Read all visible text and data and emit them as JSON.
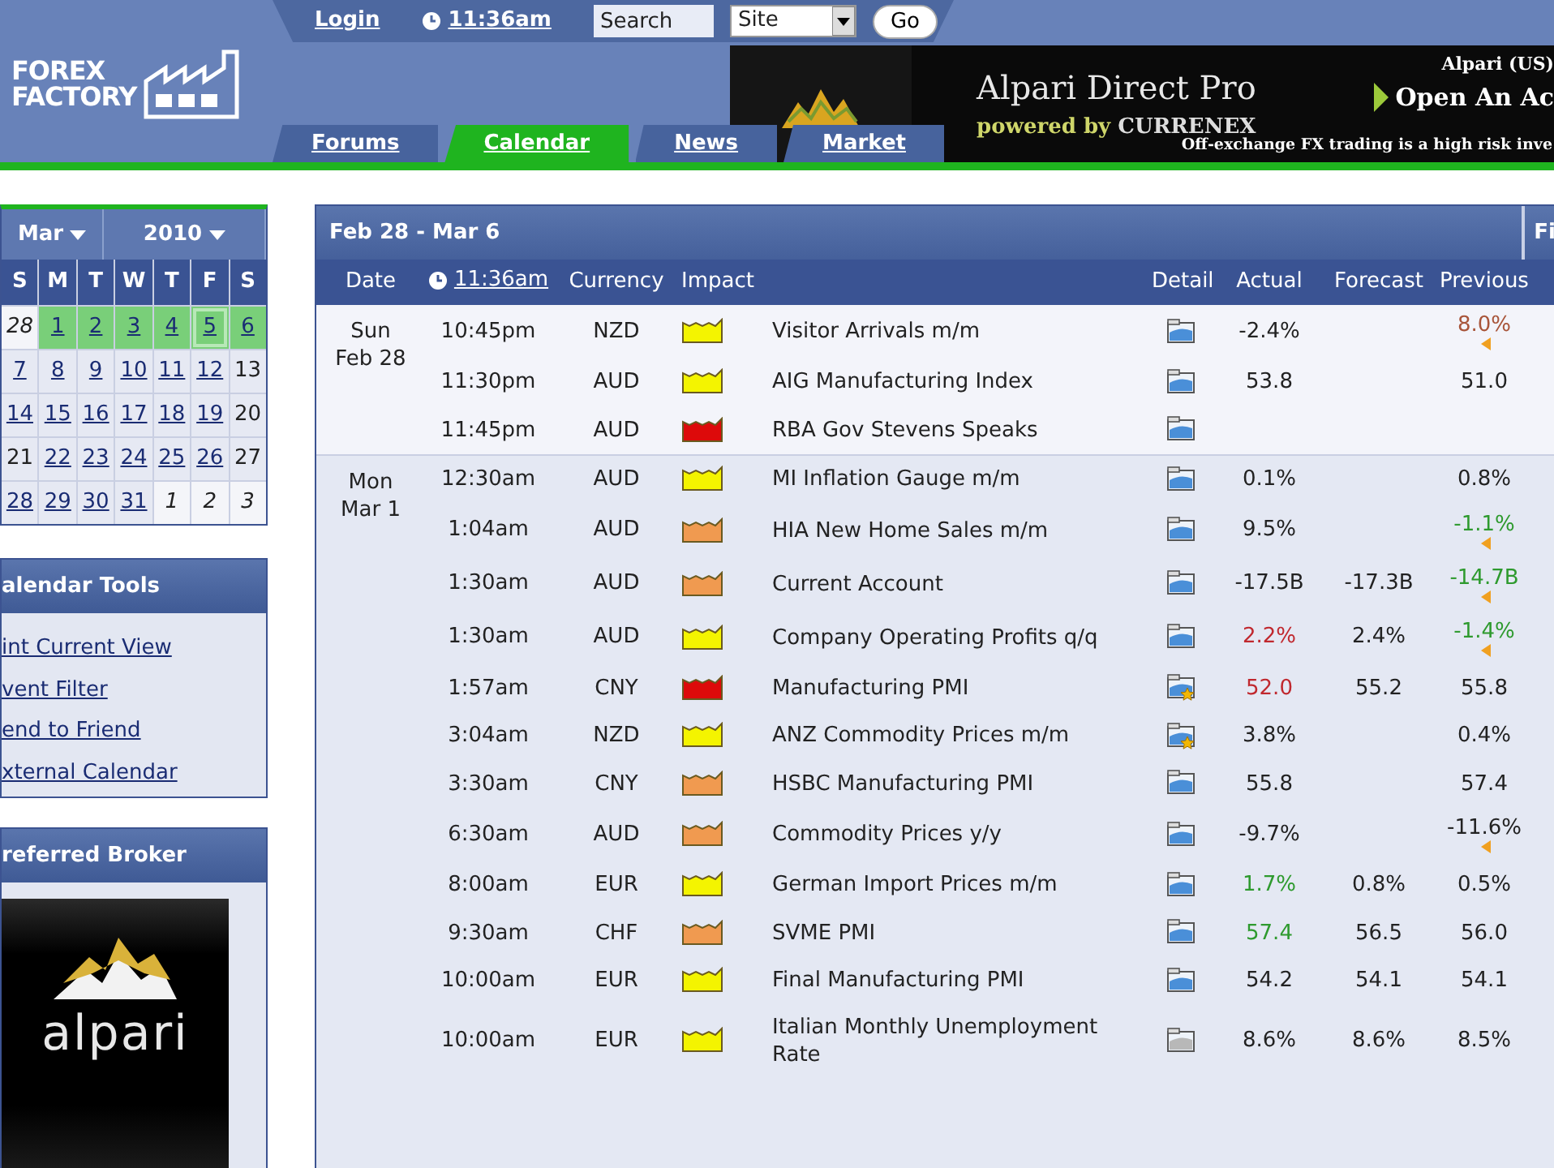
{
  "top_bar": {
    "login": "Login",
    "clock_time": "11:36am",
    "search": {
      "value": "Search"
    },
    "scope": {
      "value": "Site"
    },
    "go": "Go"
  },
  "logo": {
    "line1": "FOREX",
    "line2": "FACTORY"
  },
  "tabs": [
    {
      "label": "Forums",
      "selected": false
    },
    {
      "label": "Calendar",
      "selected": true
    },
    {
      "label": "News",
      "selected": false
    },
    {
      "label": "Market",
      "selected": false
    }
  ],
  "banner": {
    "title": "Alpari Direct Pro",
    "subtitle_prefix": "powered by",
    "subtitle_brand": "CURRENEX",
    "corner": "Alpari (US)",
    "cta": "Open An Ac",
    "disclaimer": "Off-exchange FX trading is a high risk inve"
  },
  "calendar": {
    "month": "Mar",
    "year": "2010",
    "weekdays": [
      "S",
      "M",
      "T",
      "W",
      "T",
      "F",
      "S"
    ],
    "weeks": [
      [
        {
          "d": "28",
          "kind": "other",
          "selected": false,
          "today": false
        },
        {
          "d": "1",
          "kind": "link",
          "selected": true,
          "today": false
        },
        {
          "d": "2",
          "kind": "link",
          "selected": true,
          "today": false
        },
        {
          "d": "3",
          "kind": "link",
          "selected": true,
          "today": false
        },
        {
          "d": "4",
          "kind": "link",
          "selected": true,
          "today": false
        },
        {
          "d": "5",
          "kind": "link",
          "selected": true,
          "today": true
        },
        {
          "d": "6",
          "kind": "link",
          "selected": true,
          "today": false
        }
      ],
      [
        {
          "d": "7",
          "kind": "link",
          "selected": false,
          "today": false
        },
        {
          "d": "8",
          "kind": "link",
          "selected": false,
          "today": false
        },
        {
          "d": "9",
          "kind": "link",
          "selected": false,
          "today": false
        },
        {
          "d": "10",
          "kind": "link",
          "selected": false,
          "today": false
        },
        {
          "d": "11",
          "kind": "link",
          "selected": false,
          "today": false
        },
        {
          "d": "12",
          "kind": "link",
          "selected": false,
          "today": false
        },
        {
          "d": "13",
          "kind": "plain",
          "selected": false,
          "today": false
        }
      ],
      [
        {
          "d": "14",
          "kind": "link",
          "selected": false,
          "today": false
        },
        {
          "d": "15",
          "kind": "link",
          "selected": false,
          "today": false
        },
        {
          "d": "16",
          "kind": "link",
          "selected": false,
          "today": false
        },
        {
          "d": "17",
          "kind": "link",
          "selected": false,
          "today": false
        },
        {
          "d": "18",
          "kind": "link",
          "selected": false,
          "today": false
        },
        {
          "d": "19",
          "kind": "link",
          "selected": false,
          "today": false
        },
        {
          "d": "20",
          "kind": "plain",
          "selected": false,
          "today": false
        }
      ],
      [
        {
          "d": "21",
          "kind": "plain",
          "selected": false,
          "today": false
        },
        {
          "d": "22",
          "kind": "link",
          "selected": false,
          "today": false
        },
        {
          "d": "23",
          "kind": "link",
          "selected": false,
          "today": false
        },
        {
          "d": "24",
          "kind": "link",
          "selected": false,
          "today": false
        },
        {
          "d": "25",
          "kind": "link",
          "selected": false,
          "today": false
        },
        {
          "d": "26",
          "kind": "link",
          "selected": false,
          "today": false
        },
        {
          "d": "27",
          "kind": "plain",
          "selected": false,
          "today": false
        }
      ],
      [
        {
          "d": "28",
          "kind": "link",
          "selected": false,
          "today": false
        },
        {
          "d": "29",
          "kind": "link",
          "selected": false,
          "today": false
        },
        {
          "d": "30",
          "kind": "link",
          "selected": false,
          "today": false
        },
        {
          "d": "31",
          "kind": "link",
          "selected": false,
          "today": false
        },
        {
          "d": "1",
          "kind": "other",
          "selected": false,
          "today": false
        },
        {
          "d": "2",
          "kind": "other",
          "selected": false,
          "today": false
        },
        {
          "d": "3",
          "kind": "other",
          "selected": false,
          "today": false
        }
      ]
    ]
  },
  "calendar_tools": {
    "title": "alendar Tools",
    "links": [
      "int Current View",
      "vent Filter",
      "end to Friend",
      "xternal Calendar"
    ]
  },
  "broker": {
    "title": "referred Broker",
    "logo_text": "alpari"
  },
  "schedule": {
    "title": "Feb 28 - Mar 6",
    "corner_button": "Fi",
    "columns": {
      "date": "Date",
      "time": "11:36am",
      "currency": "Currency",
      "impact": "Impact",
      "detail": "Detail",
      "actual": "Actual",
      "forecast": "Forecast",
      "previous": "Previous"
    },
    "days": [
      {
        "day": "Sun",
        "date": "Feb 28",
        "events": [
          {
            "time": "10:45pm",
            "currency": "NZD",
            "color": "#f4f400",
            "title": "Visitor Arrivals m/m",
            "kind": "plain",
            "actual": "-2.4%",
            "actual_better": false,
            "actual_worse": false,
            "previous": "8.0%",
            "previous_better": false,
            "previous_worse": true,
            "revised": true
          },
          {
            "time": "11:30pm",
            "currency": "AUD",
            "color": "#f4f400",
            "title": "AIG Manufacturing Index",
            "kind": "plain",
            "actual": "53.8",
            "actual_better": false,
            "actual_worse": false,
            "previous": "51.0",
            "previous_better": false,
            "previous_worse": false,
            "revised": false
          },
          {
            "time": "11:45pm",
            "currency": "AUD",
            "color": "#dd0a0a",
            "title": "RBA Gov Stevens Speaks",
            "kind": "plain"
          }
        ]
      },
      {
        "day": "Mon",
        "date": "Mar 1",
        "events": [
          {
            "time": "12:30am",
            "currency": "AUD",
            "color": "#f4f400",
            "title": "MI Inflation Gauge m/m",
            "kind": "plain",
            "actual": "0.1%",
            "actual_better": false,
            "actual_worse": false,
            "previous": "0.8%",
            "previous_better": false,
            "previous_worse": false,
            "revised": false
          },
          {
            "time": "1:04am",
            "currency": "AUD",
            "color": "#f09a50",
            "title": "HIA New Home Sales m/m",
            "kind": "plain",
            "actual": "9.5%",
            "actual_better": false,
            "actual_worse": false,
            "previous": "-1.1%",
            "previous_better": true,
            "previous_worse": false,
            "revised": true
          },
          {
            "time": "1:30am",
            "currency": "AUD",
            "color": "#f09a50",
            "title": "Current Account",
            "kind": "plain",
            "actual": "-17.5B",
            "actual_better": false,
            "actual_worse": false,
            "forecast": "-17.3B",
            "previous": "-14.7B",
            "previous_better": true,
            "previous_worse": false,
            "revised": true
          },
          {
            "time": "1:30am",
            "currency": "AUD",
            "color": "#f4f400",
            "title": "Company Operating Profits q/q",
            "kind": "plain",
            "actual": "2.2%",
            "actual_better": false,
            "actual_worse": true,
            "forecast": "2.4%",
            "previous": "-1.4%",
            "previous_better": true,
            "previous_worse": false,
            "revised": true
          },
          {
            "time": "1:57am",
            "currency": "CNY",
            "color": "#dd0a0a",
            "title": "Manufacturing PMI",
            "kind": "starred",
            "actual": "52.0",
            "actual_better": false,
            "actual_worse": true,
            "forecast": "55.2",
            "previous": "55.8",
            "previous_better": false,
            "previous_worse": false,
            "revised": false
          },
          {
            "time": "3:04am",
            "currency": "NZD",
            "color": "#f4f400",
            "title": "ANZ Commodity Prices m/m",
            "kind": "starred",
            "actual": "3.8%",
            "actual_better": false,
            "actual_worse": false,
            "previous": "0.4%",
            "previous_better": false,
            "previous_worse": false,
            "revised": false
          },
          {
            "time": "3:30am",
            "currency": "CNY",
            "color": "#f09a50",
            "title": "HSBC Manufacturing PMI",
            "kind": "plain",
            "actual": "55.8",
            "actual_better": false,
            "actual_worse": false,
            "previous": "57.4",
            "previous_better": false,
            "previous_worse": false,
            "revised": false
          },
          {
            "time": "6:30am",
            "currency": "AUD",
            "color": "#f09a50",
            "title": "Commodity Prices y/y",
            "kind": "plain",
            "actual": "-9.7%",
            "actual_better": false,
            "actual_worse": false,
            "previous": "-11.6%",
            "previous_better": false,
            "previous_worse": false,
            "revised": true
          },
          {
            "time": "8:00am",
            "currency": "EUR",
            "color": "#f4f400",
            "title": "German Import Prices m/m",
            "kind": "plain",
            "actual": "1.7%",
            "actual_better": true,
            "actual_worse": false,
            "forecast": "0.8%",
            "previous": "0.5%",
            "previous_better": false,
            "previous_worse": false,
            "revised": false
          },
          {
            "time": "9:30am",
            "currency": "CHF",
            "color": "#f09a50",
            "title": "SVME PMI",
            "kind": "plain",
            "actual": "57.4",
            "actual_better": true,
            "actual_worse": false,
            "forecast": "56.5",
            "previous": "56.0",
            "previous_better": false,
            "previous_worse": false,
            "revised": false
          },
          {
            "time": "10:00am",
            "currency": "EUR",
            "color": "#f4f400",
            "title": "Final Manufacturing PMI",
            "kind": "plain",
            "actual": "54.2",
            "actual_better": false,
            "actual_worse": false,
            "forecast": "54.1",
            "previous": "54.1",
            "previous_better": false,
            "previous_worse": false,
            "revised": false
          },
          {
            "time": "10:00am",
            "currency": "EUR",
            "color": "#f4f400",
            "title": "Italian Monthly Unemployment Rate",
            "kind": "grayed",
            "actual": "8.6%",
            "actual_better": false,
            "actual_worse": false,
            "forecast": "8.6%",
            "previous": "8.5%",
            "previous_better": false,
            "previous_worse": false,
            "revised": false
          }
        ]
      }
    ]
  }
}
